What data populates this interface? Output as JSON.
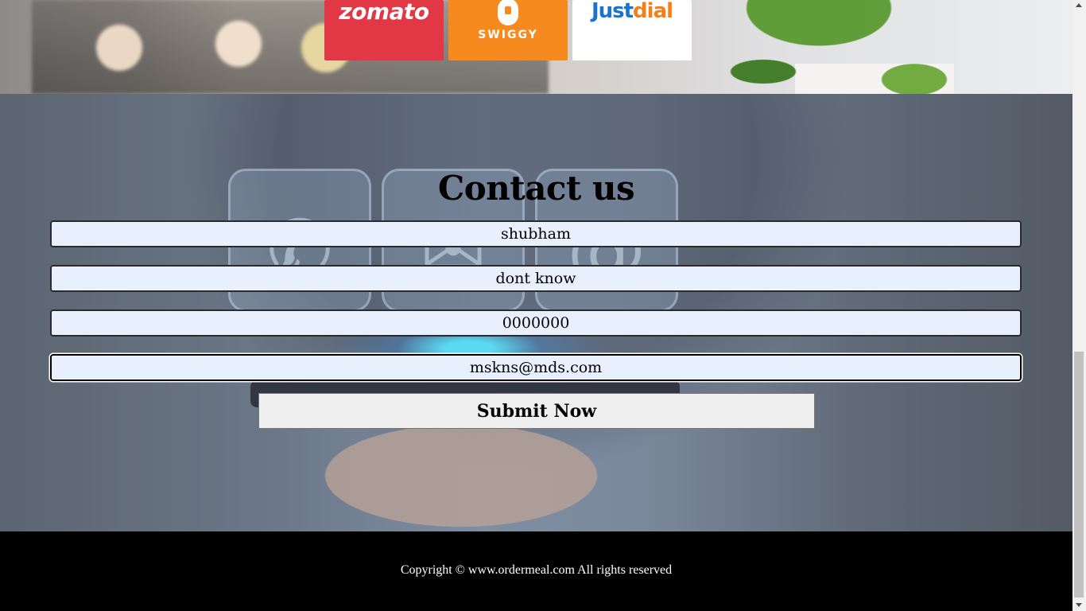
{
  "partners": {
    "zomato": "zomato",
    "swiggy": "SWIGGY",
    "justdial_a": "Just",
    "justdial_b": "dial",
    "colors": {
      "zomato": "#e23744",
      "swiggy": "#f78a1f",
      "justdial_blue": "#1874cd",
      "justdial_orange": "#f57f17"
    }
  },
  "contact": {
    "title": "Contact us",
    "fields": {
      "name": "shubham",
      "message": "dont know",
      "phone": "0000000",
      "email": "mskns@mds.com"
    },
    "submit_label": "Submit Now",
    "icons": [
      "phone-icon",
      "mail-icon",
      "at-icon"
    ]
  },
  "footer": {
    "copyright": "Copyright © www.ordermeal.com All rights reserved"
  }
}
